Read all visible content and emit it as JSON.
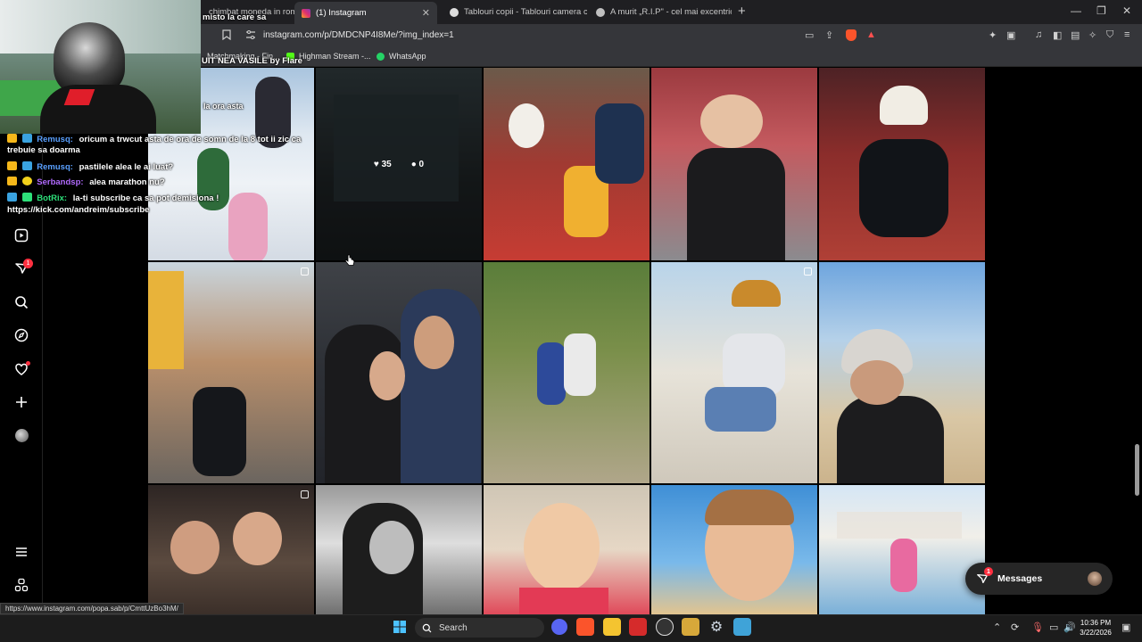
{
  "browser": {
    "tabs": [
      {
        "label": "chimbat moneda in romania",
        "active": false
      },
      {
        "label": "(1) Instagram",
        "active": true
      },
      {
        "label": "Tablouri copii - Tablouri camera copii",
        "active": false
      },
      {
        "label": "A murit „R.I.P\" - cel mai excentric pu",
        "active": false
      }
    ],
    "new_tab": "+",
    "url": "instagram.com/p/DMDCNP4I8Me/?img_index=1",
    "bookmarks": [
      "Matchmaking - Fin...",
      "Highman Stream -...",
      "WhatsApp"
    ],
    "window_controls": [
      "—",
      "❐",
      "✕"
    ],
    "tab_close": "✕"
  },
  "stream_overlay": {
    "title_line1": "misto la care sa",
    "title_line2": "UIT NEA VASILE by Flare",
    "chat": [
      {
        "user": "",
        "text": "la ora asta",
        "user_color": "#ffffff"
      },
      {
        "user": "Remusq:",
        "text": "oricum a trwcut asta de ora de somn de la 8 tot ii zic ca",
        "user_color": "#5aa0ff"
      },
      {
        "user": "",
        "text": "trebuie sa doarma",
        "user_color": "#ffffff"
      },
      {
        "user": "Remusq:",
        "text": "pastilele alea le ai luat?",
        "user_color": "#5aa0ff"
      },
      {
        "user": "Serbandsp:",
        "text": "alea marathon nu?",
        "user_color": "#b26bff"
      },
      {
        "user": "BotRix:",
        "text": "la-ti subscribe ca sa pot demisiona !",
        "user_color": "#2ee07a"
      },
      {
        "user": "",
        "text": "https://kick.com/andreim/subscribe",
        "user_color": "#ffffff"
      }
    ]
  },
  "instagram": {
    "hover_post": {
      "likes": "35",
      "comments": "0"
    },
    "messages_label": "Messages",
    "messages_badge": "1",
    "notif_badge": "1"
  },
  "status_url": "https://www.instagram.com/popa.sab/p/CmttUzBo3hM/",
  "taskbar": {
    "search_label": "Search",
    "time": "10:36 PM",
    "date": "3/22/2026"
  }
}
